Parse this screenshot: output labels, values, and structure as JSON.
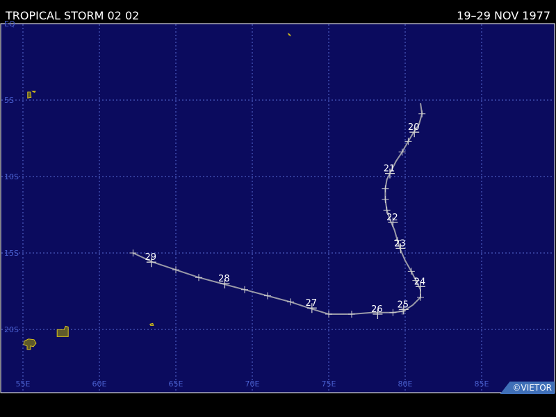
{
  "header": {
    "storm_name": "TROPICAL STORM 02 02",
    "date_range": "19–29 NOV 1977"
  },
  "credit": "©VIETOR",
  "colors": {
    "ocean": "#0b0b5e",
    "grid": "#5a6ed6",
    "grid_label": "#4a60d0",
    "land": "#d9c21a",
    "track": "#9a9aa8",
    "marker": "#d0d0d0",
    "text": "#ffffff"
  },
  "map": {
    "lon_range": [
      53.5,
      88
    ],
    "lat_range": [
      0,
      -22.5
    ],
    "lon_ticks": [
      {
        "value": 55,
        "label": "55E"
      },
      {
        "value": 60,
        "label": "60E"
      },
      {
        "value": 65,
        "label": "65E"
      },
      {
        "value": 70,
        "label": "70E"
      },
      {
        "value": 75,
        "label": "75E"
      },
      {
        "value": 80,
        "label": "80E"
      },
      {
        "value": 85,
        "label": "85E"
      }
    ],
    "lat_ticks": [
      {
        "value": 0,
        "label": "EQ"
      },
      {
        "value": -5,
        "label": "5S"
      },
      {
        "value": -10,
        "label": "10S"
      },
      {
        "value": -15,
        "label": "15S"
      },
      {
        "value": -20,
        "label": "20S"
      }
    ]
  },
  "track": {
    "points": [
      [
        81.0,
        -5.2
      ],
      [
        81.1,
        -5.9
      ],
      [
        80.9,
        -6.6
      ],
      [
        80.5,
        -7.2
      ],
      [
        80.2,
        -7.7
      ],
      [
        79.8,
        -8.4
      ],
      [
        79.4,
        -9.0
      ],
      [
        79.1,
        -9.6
      ],
      [
        78.8,
        -10.2
      ],
      [
        78.7,
        -10.8
      ],
      [
        78.7,
        -11.5
      ],
      [
        78.8,
        -12.2
      ],
      [
        79.0,
        -12.8
      ],
      [
        79.3,
        -13.5
      ],
      [
        79.5,
        -14.2
      ],
      [
        79.7,
        -14.8
      ],
      [
        80.0,
        -15.5
      ],
      [
        80.4,
        -16.2
      ],
      [
        80.7,
        -16.8
      ],
      [
        81.0,
        -17.4
      ],
      [
        81.0,
        -17.9
      ],
      [
        80.5,
        -18.4
      ],
      [
        79.9,
        -18.8
      ],
      [
        79.2,
        -18.9
      ],
      [
        78.5,
        -18.9
      ],
      [
        77.8,
        -18.9
      ],
      [
        76.5,
        -19.0
      ],
      [
        75.0,
        -19.0
      ],
      [
        73.7,
        -18.6
      ],
      [
        72.5,
        -18.2
      ],
      [
        71.0,
        -17.8
      ],
      [
        69.5,
        -17.4
      ],
      [
        68.0,
        -17.0
      ],
      [
        66.5,
        -16.6
      ],
      [
        65.0,
        -16.1
      ],
      [
        63.5,
        -15.6
      ],
      [
        62.2,
        -15.0
      ]
    ],
    "minor_markers": [
      [
        81.1,
        -5.9
      ],
      [
        80.2,
        -7.7
      ],
      [
        79.8,
        -8.4
      ],
      [
        78.7,
        -10.8
      ],
      [
        78.7,
        -11.5
      ],
      [
        78.8,
        -12.2
      ],
      [
        79.5,
        -14.2
      ],
      [
        80.4,
        -16.2
      ],
      [
        80.7,
        -16.8
      ],
      [
        81.0,
        -17.9
      ],
      [
        79.8,
        -18.8
      ],
      [
        79.2,
        -18.9
      ],
      [
        76.5,
        -19.0
      ],
      [
        75.0,
        -19.0
      ],
      [
        72.5,
        -18.2
      ],
      [
        71.0,
        -17.8
      ],
      [
        69.5,
        -17.4
      ],
      [
        66.5,
        -16.6
      ],
      [
        65.0,
        -16.1
      ],
      [
        62.2,
        -15.0
      ]
    ],
    "daily": [
      {
        "day": "20",
        "lon": 80.6,
        "lat": -7.1
      },
      {
        "day": "21",
        "lon": 79.0,
        "lat": -9.8
      },
      {
        "day": "22",
        "lon": 79.2,
        "lat": -13.0
      },
      {
        "day": "23",
        "lon": 79.7,
        "lat": -14.7
      },
      {
        "day": "24",
        "lon": 81.0,
        "lat": -17.2
      },
      {
        "day": "25",
        "lon": 79.9,
        "lat": -18.7
      },
      {
        "day": "26",
        "lon": 78.2,
        "lat": -19.0
      },
      {
        "day": "27",
        "lon": 73.9,
        "lat": -18.6
      },
      {
        "day": "28",
        "lon": 68.2,
        "lat": -17.0
      },
      {
        "day": "29",
        "lon": 63.4,
        "lat": -15.6
      }
    ]
  },
  "land": [
    {
      "name": "madagascar-fragment",
      "lon": 55.5,
      "lat": -20.9
    },
    {
      "name": "mauritius",
      "lon": 57.6,
      "lat": -20.2
    },
    {
      "name": "seychelles",
      "lon": 55.4,
      "lat": -4.6
    },
    {
      "name": "rodrigues",
      "lon": 63.4,
      "lat": -19.7
    },
    {
      "name": "chagos-islet",
      "lon": 72.4,
      "lat": -0.7
    }
  ]
}
